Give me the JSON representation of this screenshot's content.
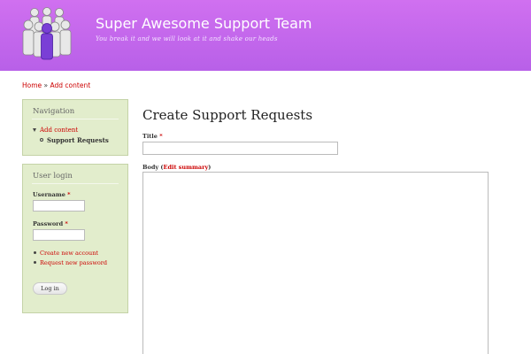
{
  "site": {
    "name": "Super Awesome Support Team",
    "slogan": "You break it and we will look at it and shake our heads",
    "logo_icon": "people-group-icon"
  },
  "breadcrumb": {
    "home": "Home",
    "separator": " » ",
    "current": "Add content"
  },
  "navigation": {
    "title": "Navigation",
    "items": [
      {
        "label": "Add content",
        "icon": "triangle-down-icon"
      }
    ],
    "subitems": [
      {
        "label": "Support Requests",
        "icon": "circle-bullet-icon"
      }
    ]
  },
  "user_login": {
    "title": "User login",
    "username_label": "Username",
    "password_label": "Password",
    "required_marker": "*",
    "username_value": "",
    "password_value": "",
    "links": [
      {
        "label": "Create new account"
      },
      {
        "label": "Request new password"
      }
    ],
    "button_label": "Log in"
  },
  "main": {
    "page_title": "Create Support Requests",
    "title_label": "Title",
    "title_required": "*",
    "title_value": "",
    "body_label": "Body",
    "body_open": " (",
    "edit_summary_link": "Edit summary",
    "body_close": ")",
    "body_value": ""
  },
  "colors": {
    "header_gradient_top": "#d070f0",
    "header_gradient_bottom": "#b860e8",
    "sidebar_bg": "#e2edcc",
    "link": "#cc0000"
  }
}
